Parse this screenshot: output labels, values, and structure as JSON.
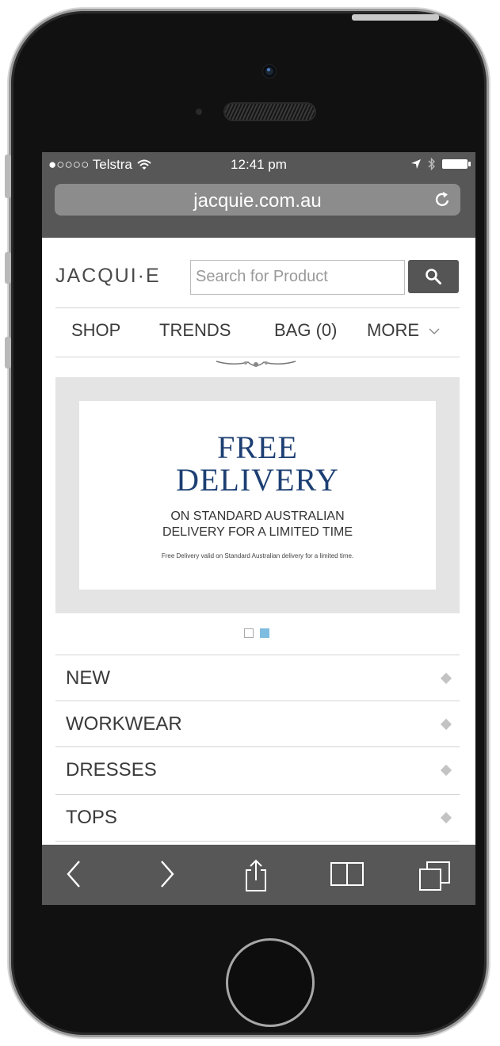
{
  "status_bar": {
    "carrier": "●○○○○ Telstra",
    "time": "12:41 pm"
  },
  "browser": {
    "url": "jacquie.com.au"
  },
  "site": {
    "logo": "JACQUI·E",
    "search_placeholder": "Search for Product",
    "nav": {
      "shop": "SHOP",
      "trends": "TRENDS",
      "bag": "BAG (0)",
      "more": "MORE"
    }
  },
  "banner": {
    "title_line1": "FREE",
    "title_line2": "DELIVERY",
    "sub_line1": "ON STANDARD AUSTRALIAN",
    "sub_line2": "DELIVERY FOR A LIMITED TIME",
    "fine_print": "Free Delivery valid on Standard Australian delivery for a limited time.",
    "active_slide": 2,
    "slide_count": 2
  },
  "categories": [
    {
      "label": "NEW"
    },
    {
      "label": "WORKWEAR"
    },
    {
      "label": "DRESSES"
    },
    {
      "label": "TOPS"
    }
  ],
  "colors": {
    "banner_title": "#1d3f73",
    "pager_active": "#7ebce0",
    "chrome_gray": "#575757"
  }
}
